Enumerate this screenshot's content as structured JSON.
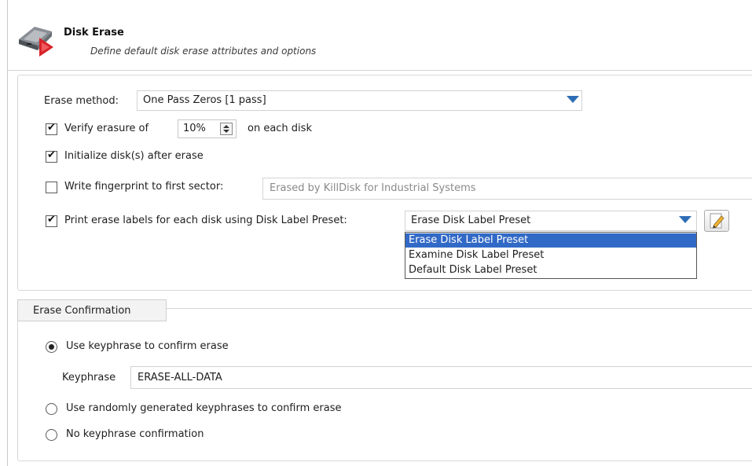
{
  "header": {
    "title": "Disk Erase",
    "subtitle": "Define default disk erase attributes and options",
    "icon": "disk-erase-icon"
  },
  "erase_method": {
    "label": "Erase method:",
    "value": "One Pass Zeros [1 pass]"
  },
  "verify": {
    "checked": true,
    "label_before": "Verify erasure of",
    "value": "10%",
    "label_after": "on each disk"
  },
  "initialize": {
    "checked": true,
    "label": "Initialize disk(s) after erase"
  },
  "fingerprint": {
    "checked": false,
    "label": "Write fingerprint to first sector:",
    "value": "Erased by KillDisk for Industrial Systems"
  },
  "print_labels": {
    "checked": true,
    "label": "Print erase labels for each disk using Disk Label Preset:",
    "value": "Erase Disk Label Preset",
    "options": [
      "Erase Disk Label Preset",
      "Examine Disk Label Preset",
      "Default Disk Label Preset"
    ],
    "selected_index": 0
  },
  "confirmation": {
    "group_title": "Erase Confirmation",
    "options": [
      {
        "label": "Use keyphrase to confirm erase",
        "selected": true
      },
      {
        "label": "Use randomly generated keyphrases to confirm erase",
        "selected": false
      },
      {
        "label": "No keyphrase confirmation",
        "selected": false
      }
    ],
    "keyphrase_label": "Keyphrase",
    "keyphrase_value": "ERASE-ALL-DATA"
  },
  "colors": {
    "accent_arrow": "#2d6db5",
    "selection": "#3169c6"
  }
}
